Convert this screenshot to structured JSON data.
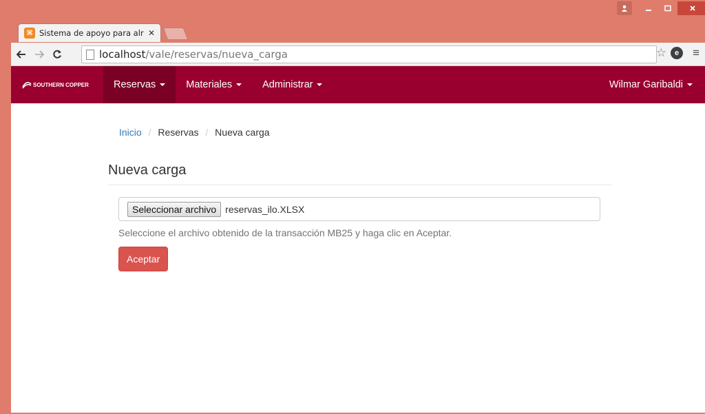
{
  "window": {
    "tab_title": "Sistema de apoyo para alr",
    "tab_close": "✕",
    "favicon_glyph": "⌘",
    "colors": {
      "frame": "#e07c6c",
      "close": "#c8473b"
    }
  },
  "address_bar": {
    "host": "localhost",
    "path": "/vale/reservas/nueva_carga"
  },
  "navbar": {
    "brand": "SOUTHERN COPPER",
    "items": [
      {
        "label": "Reservas"
      },
      {
        "label": "Materiales"
      },
      {
        "label": "Administrar"
      }
    ],
    "user": "Wilmar Garibaldi",
    "colors": {
      "bar": "#99002f",
      "active": "#7a0025"
    }
  },
  "breadcrumb": {
    "home": "Inicio",
    "section": "Reservas",
    "current": "Nueva carga",
    "separator": "/"
  },
  "page": {
    "title": "Nueva carga",
    "file_button": "Seleccionar archivo",
    "file_name": "reservas_ilo.XLSX",
    "help": "Seleccione el archivo obtenido de la transacción MB25 y haga clic en Aceptar.",
    "submit": "Aceptar",
    "colors": {
      "submit": "#d9534f",
      "link": "#337ab7"
    }
  }
}
